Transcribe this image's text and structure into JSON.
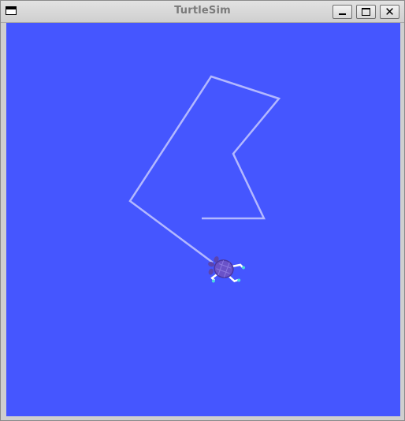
{
  "window": {
    "title": "TurtleSim"
  },
  "titlebar_buttons": {
    "menu_icon": "window-menu-icon",
    "minimize_icon": "minimize-icon",
    "maximize_icon": "maximize-icon",
    "close_icon": "close-icon",
    "close_glyph": "✕"
  },
  "simulation": {
    "background_color": "#4556ff",
    "pen_color": "#b3b8ff",
    "turtle_shell_color": "#6a52c8",
    "turtle_limb_color": "#ffffff"
  }
}
